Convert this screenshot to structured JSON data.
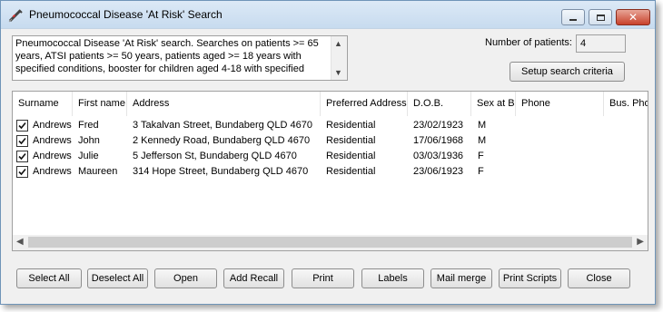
{
  "window": {
    "title": "Pneumococcal Disease 'At Risk' Search",
    "min_glyph": "",
    "close_glyph": "✕"
  },
  "description": "Pneumococcal Disease 'At Risk' search. Searches on patients >= 65 years, ATSI patients >= 50 years, patients aged >= 18 years with specified conditions, booster for children aged 4-18 with specified",
  "patients": {
    "label": "Number of patients:",
    "value": "4"
  },
  "setup_button": "Setup search criteria",
  "table": {
    "columns": [
      "Surname",
      "First name",
      "Address",
      "Preferred Address",
      "D.O.B.",
      "Sex at B",
      "Phone",
      "Bus. Pho"
    ],
    "rows": [
      [
        "Andrews",
        "Fred",
        "3 Takalvan Street,  Bundaberg QLD 4670",
        "Residential",
        "23/02/1923",
        "M",
        "",
        ""
      ],
      [
        "Andrews",
        "John",
        "2 Kennedy Road,  Bundaberg QLD 4670",
        "Residential",
        "17/06/1968",
        "M",
        "",
        ""
      ],
      [
        "Andrews",
        "Julie",
        "5 Jefferson St,  Bundaberg QLD 4670",
        "Residential",
        "03/03/1936",
        "F",
        "",
        ""
      ],
      [
        "Andrews",
        "Maureen",
        "314 Hope Street,  Bundaberg QLD 4670",
        "Residential",
        "23/06/1923",
        "F",
        "",
        ""
      ]
    ],
    "checked": [
      true,
      true,
      true,
      true
    ]
  },
  "buttons": {
    "select_all": "Select All",
    "deselect_all": "Deselect All",
    "open": "Open",
    "add_recall": "Add Recall",
    "print": "Print",
    "labels": "Labels",
    "mail_merge": "Mail merge",
    "print_scripts": "Print Scripts",
    "close": "Close"
  },
  "icons": {
    "app": "syringe-icon",
    "scroll_up": "▲",
    "scroll_down": "▼",
    "scroll_left": "◀",
    "scroll_right": "▶"
  }
}
